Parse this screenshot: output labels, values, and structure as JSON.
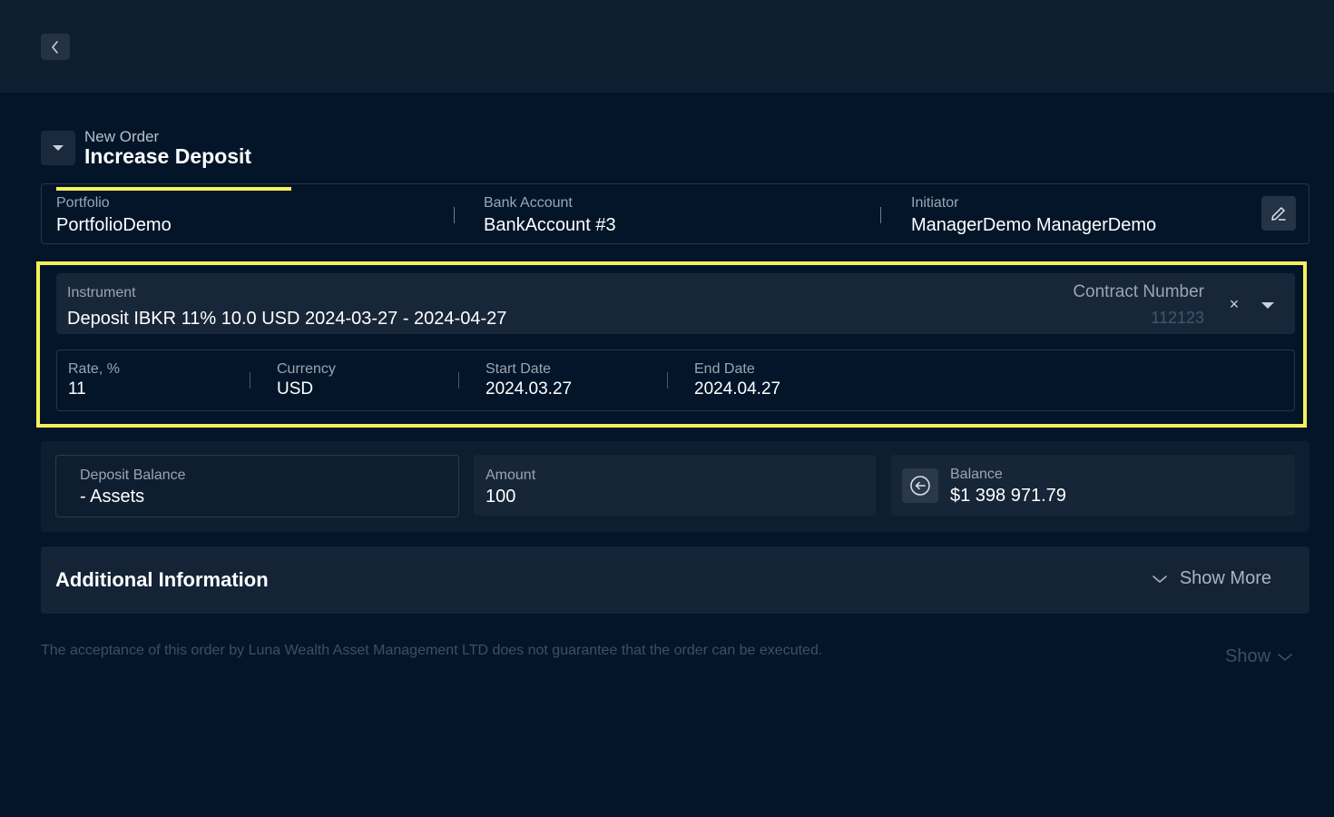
{
  "header": {
    "back_icon": "chevron-left-icon"
  },
  "order": {
    "subtitle": "New Order",
    "title": "Increase Deposit"
  },
  "info": {
    "portfolio_label": "Portfolio",
    "portfolio_value": "PortfolioDemo",
    "bank_label": "Bank Account",
    "bank_value": "BankAccount #3",
    "initiator_label": "Initiator",
    "initiator_value": "ManagerDemo ManagerDemo",
    "edit_icon": "pencil-icon"
  },
  "instrument": {
    "label": "Instrument",
    "value": "Deposit IBKR 11% 10.0 USD 2024-03-27 - 2024-04-27",
    "contract_label": "Contract Number",
    "contract_value": "112123",
    "clear": "×"
  },
  "details": {
    "rate_label": "Rate, %",
    "rate_value": "11",
    "currency_label": "Currency",
    "currency_value": "USD",
    "start_label": "Start Date",
    "start_value": "2024.03.27",
    "end_label": "End Date",
    "end_value": "2024.04.27"
  },
  "balances": {
    "deposit_label": "Deposit Balance",
    "deposit_value": "- Assets",
    "amount_label": "Amount",
    "amount_value": "100",
    "balance_label": "Balance",
    "balance_value": "$1 398 971.79"
  },
  "additional": {
    "title": "Additional Information",
    "show_more": "Show More"
  },
  "footer": {
    "disclaimer": "The acceptance of this order by Luna Wealth Asset Management LTD does not guarantee that the order can be executed.",
    "show": "Show"
  },
  "colors": {
    "background": "#04152a",
    "accent": "#f4f25a",
    "panel": "#142336"
  }
}
